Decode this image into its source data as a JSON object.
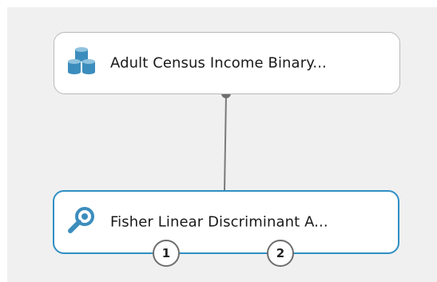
{
  "nodes": {
    "dataset": {
      "label": "Adult Census Income Binary...",
      "icon": "database-icon"
    },
    "module": {
      "label": "Fisher Linear Discriminant A...",
      "icon": "magnifier-icon"
    }
  },
  "ports": {
    "output_1": "1",
    "output_2": "2"
  },
  "colors": {
    "selected_border": "#2f8fc4",
    "icon_blue": "#3b8dbd",
    "connector": "#6e6e6e",
    "canvas_bg": "#f0f0f0"
  }
}
